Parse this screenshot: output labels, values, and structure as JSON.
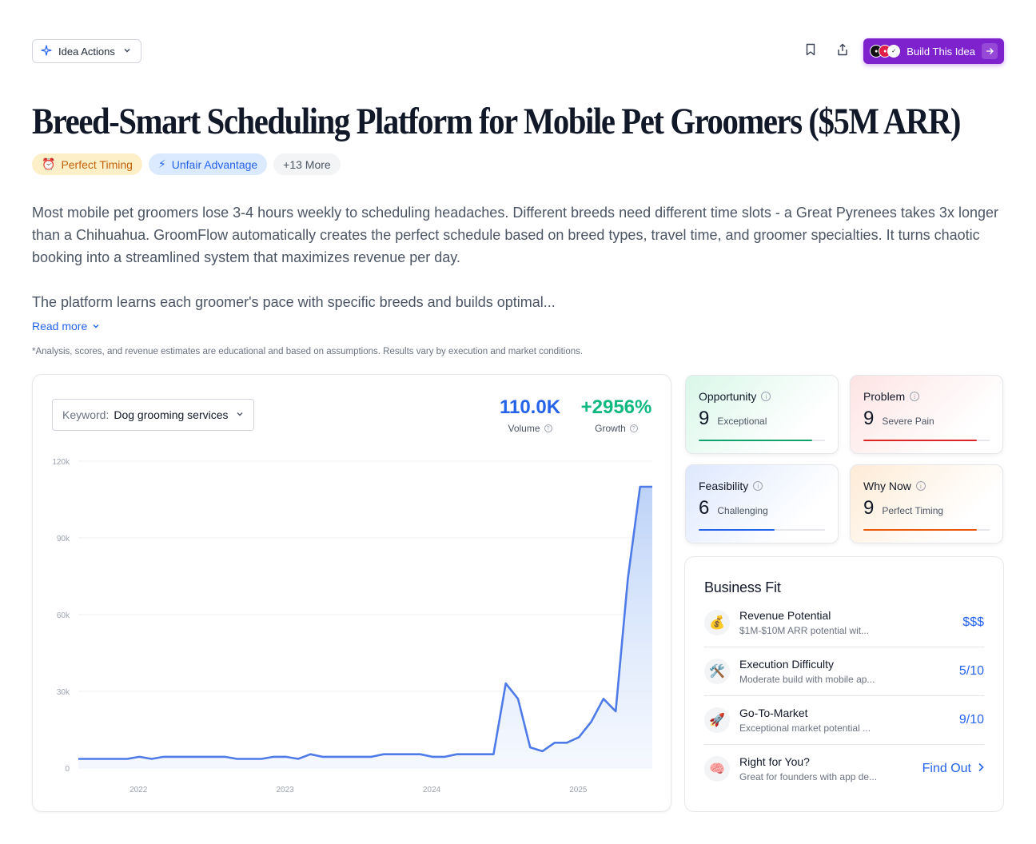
{
  "toolbar": {
    "idea_actions_label": "Idea Actions",
    "build_label": "Build This Idea"
  },
  "page": {
    "title": "Breed-Smart Scheduling Platform for Mobile Pet Groomers ($5M ARR)",
    "tags": [
      {
        "icon": "⏰",
        "label": "Perfect Timing"
      },
      {
        "icon": "⚡",
        "label": "Unfair Advantage"
      },
      {
        "label": "+13 More"
      }
    ],
    "description": [
      "Most mobile pet groomers lose 3-4 hours weekly to scheduling headaches. Different breeds need different time slots - a Great Pyrenees takes 3x longer than a Chihuahua. GroomFlow automatically creates the perfect schedule based on breed types, travel time, and groomer specialties. It turns chaotic booking into a streamlined system that maximizes revenue per day.",
      "The platform learns each groomer's pace with specific breeds and builds optimal..."
    ],
    "read_more": "Read more",
    "disclaimer": "*Analysis, scores, and revenue estimates are educational and based on assumptions. Results vary by execution and market conditions."
  },
  "trend": {
    "keyword_label": "Keyword:",
    "keyword_value": "Dog grooming services",
    "volume_value": "110.0K",
    "volume_label": "Volume",
    "growth_value": "+2956%",
    "growth_label": "Growth"
  },
  "chart_data": {
    "type": "area",
    "ylim": [
      0,
      120000
    ],
    "y_ticks": [
      "0",
      "30k",
      "60k",
      "90k",
      "120k"
    ],
    "x_ticks": [
      "2022",
      "2023",
      "2024",
      "2025"
    ],
    "x_start": 2021.59,
    "x_step_years": 0.0833,
    "grid": true,
    "color": "#4f7be8",
    "values": [
      3600,
      3600,
      3600,
      3600,
      3600,
      4400,
      3600,
      4400,
      4400,
      4400,
      4400,
      4400,
      4400,
      3600,
      3600,
      3600,
      4400,
      4400,
      3600,
      5400,
      4400,
      4400,
      4400,
      4400,
      4400,
      5400,
      5400,
      5400,
      5400,
      4400,
      4400,
      5400,
      5400,
      5400,
      5400,
      33100,
      27100,
      8100,
      6600,
      9900,
      9900,
      12100,
      18100,
      27100,
      22200,
      74000,
      110000,
      110000
    ]
  },
  "scores": [
    {
      "name": "Opportunity",
      "value": "9",
      "word": "Exceptional",
      "fraction": 0.9,
      "color": "#10a36e"
    },
    {
      "name": "Problem",
      "value": "9",
      "word": "Severe Pain",
      "fraction": 0.9,
      "color": "#dc2626"
    },
    {
      "name": "Feasibility",
      "value": "6",
      "word": "Challenging",
      "fraction": 0.6,
      "color": "#2563eb"
    },
    {
      "name": "Why Now",
      "value": "9",
      "word": "Perfect Timing",
      "fraction": 0.9,
      "color": "#ea580c"
    }
  ],
  "business_fit": {
    "title": "Business Fit",
    "rows": [
      {
        "icon": "💰",
        "name": "Revenue Potential",
        "sub": "$1M-$10M ARR potential wit...",
        "value": "$$$"
      },
      {
        "icon": "🛠️",
        "name": "Execution Difficulty",
        "sub": "Moderate build with mobile ap...",
        "value": "5/10"
      },
      {
        "icon": "🚀",
        "name": "Go-To-Market",
        "sub": "Exceptional market potential ...",
        "value": "9/10"
      },
      {
        "icon": "🧠",
        "name": "Right for You?",
        "sub": "Great for founders with app de...",
        "value": "Find Out"
      }
    ]
  }
}
